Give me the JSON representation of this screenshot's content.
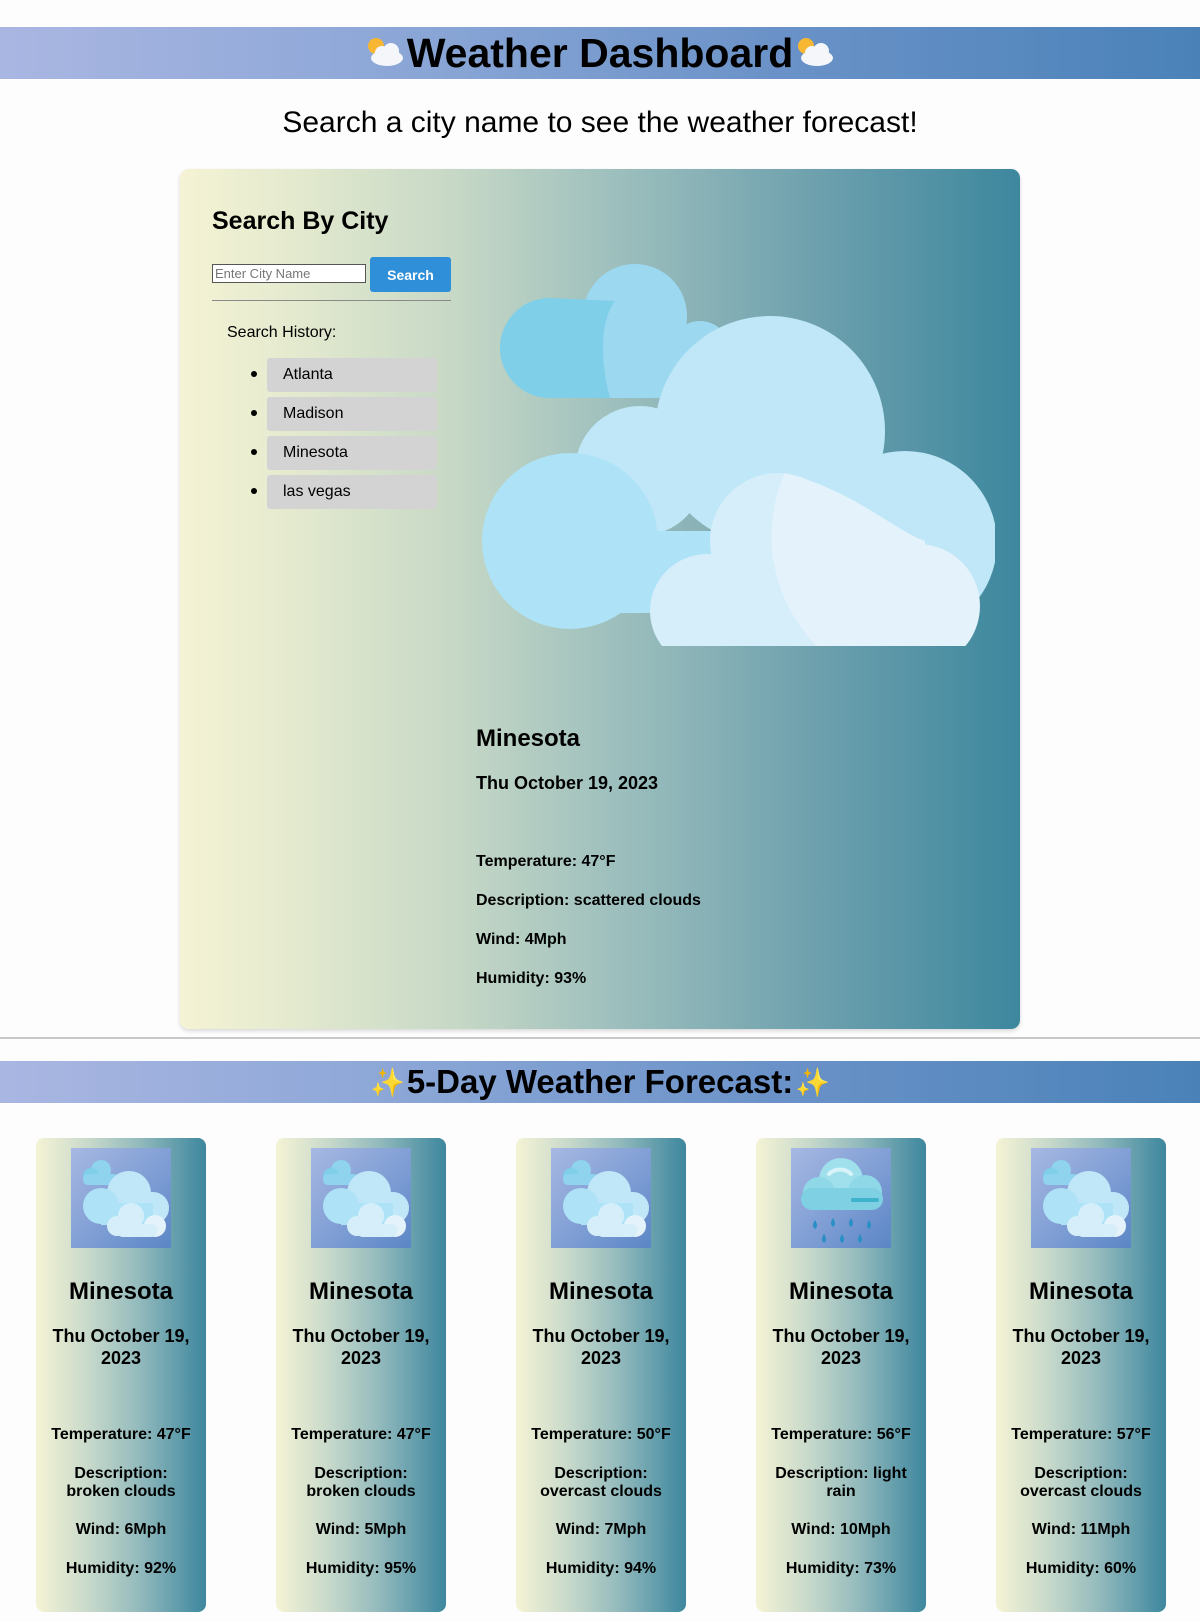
{
  "header": {
    "title": "Weather Dashboard",
    "title_icon": "sun-behind-cloud-icon"
  },
  "subtitle": "Search a city name to see the weather forecast!",
  "search": {
    "title": "Search By City",
    "placeholder": "Enter City Name",
    "button_label": "Search",
    "button_color": "#2f8fd8"
  },
  "history": {
    "label": "Search History:",
    "items": [
      "Atlanta",
      "Madison",
      "Minesota",
      "las vegas"
    ]
  },
  "current": {
    "icon": "scattered-clouds-icon",
    "city": "Minesota",
    "date": "Thu October 19, 2023",
    "temperature": "Temperature: 47°F",
    "description": "Description: scattered clouds",
    "wind": "Wind: 4Mph",
    "humidity": "Humidity: 93%"
  },
  "forecast": {
    "title": "5-Day Weather Forecast:",
    "title_icon": "sparkles-icon",
    "days": [
      {
        "icon": "broken-clouds-icon",
        "city": "Minesota",
        "date": "Thu October 19, 2023",
        "temperature": "Temperature: 47°F",
        "description": "Description: broken clouds",
        "wind": "Wind: 6Mph",
        "humidity": "Humidity: 92%"
      },
      {
        "icon": "broken-clouds-icon",
        "city": "Minesota",
        "date": "Thu October 19, 2023",
        "temperature": "Temperature: 47°F",
        "description": "Description: broken clouds",
        "wind": "Wind: 5Mph",
        "humidity": "Humidity: 95%"
      },
      {
        "icon": "overcast-clouds-icon",
        "city": "Minesota",
        "date": "Thu October 19, 2023",
        "temperature": "Temperature: 50°F",
        "description": "Description: overcast clouds",
        "wind": "Wind: 7Mph",
        "humidity": "Humidity: 94%"
      },
      {
        "icon": "light-rain-icon",
        "city": "Minesota",
        "date": "Thu October 19, 2023",
        "temperature": "Temperature: 56°F",
        "description": "Description: light rain",
        "wind": "Wind: 10Mph",
        "humidity": "Humidity: 73%"
      },
      {
        "icon": "overcast-clouds-icon",
        "city": "Minesota",
        "date": "Thu October 19, 2023",
        "temperature": "Temperature: 57°F",
        "description": "Description: overcast clouds",
        "wind": "Wind: 11Mph",
        "humidity": "Humidity: 60%"
      }
    ]
  }
}
